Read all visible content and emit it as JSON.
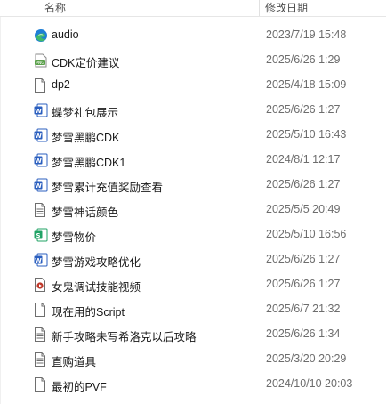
{
  "header": {
    "name_label": "名称",
    "date_label": "修改日期"
  },
  "files": [
    {
      "name": "audio",
      "date": "2023/7/19 15:48",
      "icon": "edge-icon"
    },
    {
      "name": "CDK定价建议",
      "date": "2025/6/26 1:29",
      "icon": "image-file-icon"
    },
    {
      "name": "dp2",
      "date": "2025/4/18 15:09",
      "icon": "blank-file-icon"
    },
    {
      "name": "蝶梦礼包展示",
      "date": "2025/6/26 1:27",
      "icon": "word-doc-icon"
    },
    {
      "name": "梦雪黑鹏CDK",
      "date": "2025/5/10 16:43",
      "icon": "word-doc-icon"
    },
    {
      "name": "梦雪黑鹏CDK1",
      "date": "2024/8/1 12:17",
      "icon": "word-doc-icon"
    },
    {
      "name": "梦雪累计充值奖励查看",
      "date": "2025/6/26 1:27",
      "icon": "word-doc-icon"
    },
    {
      "name": "梦雪神话颜色",
      "date": "2025/5/5 20:49",
      "icon": "text-file-icon"
    },
    {
      "name": "梦雪物价",
      "date": "2025/5/10 16:56",
      "icon": "spreadsheet-icon"
    },
    {
      "name": "梦雪游戏攻略优化",
      "date": "2025/6/26 1:27",
      "icon": "word-doc-icon"
    },
    {
      "name": "女鬼调试技能视频",
      "date": "2025/6/26 1:27",
      "icon": "video-file-icon"
    },
    {
      "name": "现在用的Script",
      "date": "2025/6/7 21:32",
      "icon": "blank-file-icon"
    },
    {
      "name": "新手攻略未写希洛克以后攻略",
      "date": "2025/6/26 1:34",
      "icon": "text-file-icon"
    },
    {
      "name": "直购道具",
      "date": "2025/3/20 20:29",
      "icon": "text-file-icon"
    },
    {
      "name": "最初的PVF",
      "date": "2024/10/10 20:03",
      "icon": "blank-file-icon"
    }
  ],
  "colors": {
    "word_blue": "#2b5fbf",
    "edge_blue": "#1f7fd6",
    "edge_green": "#3fb96a",
    "sheet_green": "#21a366",
    "video_red": "#c0392b",
    "image_green": "#5aa04a"
  }
}
